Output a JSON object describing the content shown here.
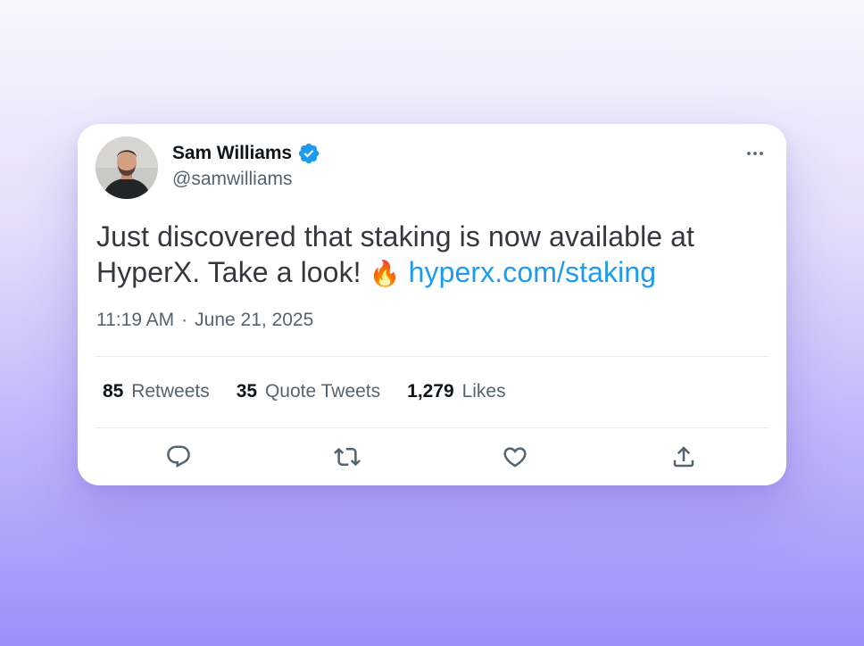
{
  "tweet": {
    "author_name": "Sam Williams",
    "author_handle": "@samwilliams",
    "verified": true,
    "text_before_link": "Just discovered that staking is now available at HyperX. Take a look! ",
    "emoji": "🔥",
    "link_text": "hyperx.com/staking",
    "time": "11:19 AM",
    "separator": "·",
    "date": "June 21, 2025"
  },
  "stats": [
    {
      "count": "85",
      "label": "Retweets"
    },
    {
      "count": "35",
      "label": "Quote Tweets"
    },
    {
      "count": "1,279",
      "label": "Likes"
    }
  ],
  "icons": {
    "more": "more-horizontal-icon",
    "verified": "verified-badge-icon",
    "reply": "reply-icon",
    "retweet": "retweet-icon",
    "like": "like-icon",
    "share": "share-icon"
  },
  "colors": {
    "link": "#1d9bf0",
    "verified": "#1d9bf0",
    "text": "#0f1419",
    "muted": "#536471",
    "action_icon": "#536471"
  }
}
